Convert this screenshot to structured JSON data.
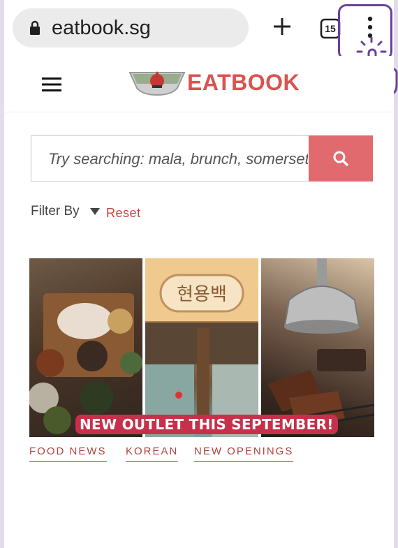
{
  "browser": {
    "url": "eatbook.sg",
    "tab_count": "15",
    "icons": [
      "lock-icon",
      "plus-icon",
      "tabs-icon",
      "menu-dots-icon",
      "hand-pointer-icon"
    ],
    "highlight_color": "#6b3fa0"
  },
  "site": {
    "logo_text": "EATBOOK",
    "brand_color": "#d9534f"
  },
  "search": {
    "placeholder": "Try searching: mala, brunch, somerset..",
    "button_color": "#e06a6d"
  },
  "filter": {
    "label": "Filter By",
    "reset_label": "Reset"
  },
  "article": {
    "sign_text": "현용백",
    "banner": "NEW OUTLET THIS SEPTEMBER!",
    "tags": [
      "FOOD NEWS",
      "KOREAN",
      "NEW OPENINGS"
    ]
  }
}
